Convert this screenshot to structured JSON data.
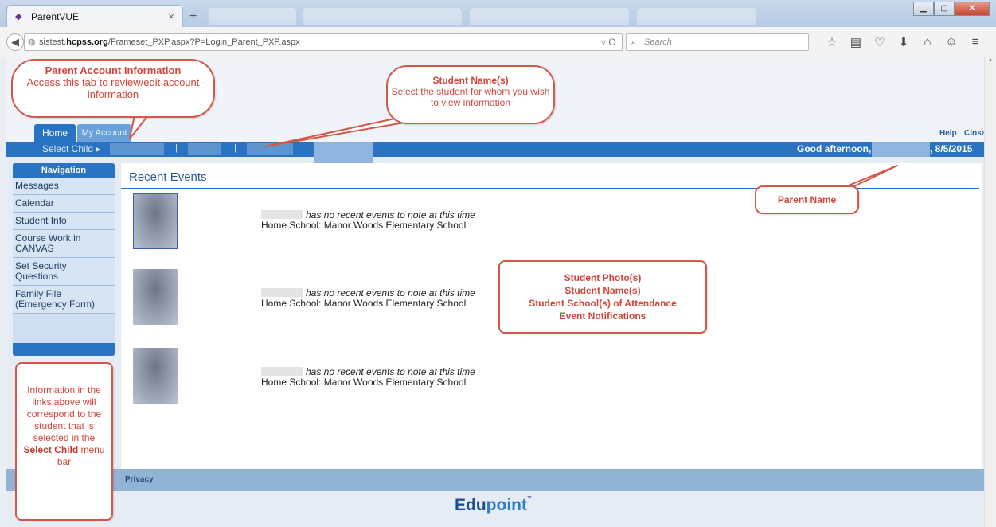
{
  "browser": {
    "tab_title": "ParentVUE",
    "tab_close": "×",
    "new_tab": "+",
    "url_domain": "hcpss.org",
    "url_prefix": "sistest.",
    "url_path": "/Frameset_PXP.aspx?P=Login_Parent_PXP.aspx",
    "search_placeholder": "Search"
  },
  "header": {
    "tabs": [
      {
        "label": "Home"
      },
      {
        "label": "My Account"
      }
    ],
    "help": "Help",
    "close": "Close",
    "select_child": "Select Child ▸",
    "greeting": "Good afternoon,",
    "date": ", 8/5/2015"
  },
  "sidebar": {
    "title": "Navigation",
    "items": [
      {
        "label": "Messages"
      },
      {
        "label": "Calendar"
      },
      {
        "label": "Student Info"
      },
      {
        "label": "Course Work in CANVAS"
      },
      {
        "label": "Set Security Questions"
      },
      {
        "label": "Family File (Emergency Form)"
      }
    ]
  },
  "main": {
    "heading": "Recent Events",
    "events": [
      {
        "note": "has no recent events to note at this time",
        "school": "Home School: Manor Woods Elementary School"
      },
      {
        "note": "has no recent events to note at this time",
        "school": "Home School: Manor Woods Elementary School"
      },
      {
        "note": "has no recent events to note at this time",
        "school": "Home School: Manor Woods Elementary School"
      }
    ]
  },
  "footer": {
    "privacy": "Privacy",
    "logo_a": "Edu",
    "logo_b": "point",
    "logo_tm": "™"
  },
  "callouts": {
    "account": {
      "title": "Parent Account Information",
      "body": "Access this tab to review/edit account information"
    },
    "student_names": {
      "title": "Student Name(s)",
      "body": "Select the student for whom you wish to view information"
    },
    "parent_name": {
      "title": "Parent Name"
    },
    "photos": {
      "l1": "Student Photo(s)",
      "l2": "Student Name(s)",
      "l3": "Student School(s) of Attendance",
      "l4": "Event Notifications"
    },
    "info": {
      "pre": "Information in the links above will correspond to the student that is selected in the",
      "bold": "Select Child",
      "post": "menu bar"
    }
  },
  "colors": {
    "accent": "#2a72c2",
    "callout": "#d4574a"
  }
}
